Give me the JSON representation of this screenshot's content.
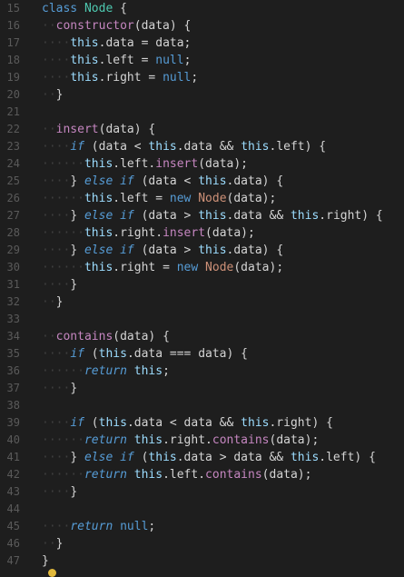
{
  "editor": {
    "lines": [
      {
        "n": "15",
        "tokens": [
          {
            "t": "class ",
            "c": "kw"
          },
          {
            "t": "Node",
            "c": "cls"
          },
          {
            "t": " {",
            "c": "punc"
          }
        ]
      },
      {
        "n": "16",
        "tokens": [
          {
            "t": "··",
            "c": "guide"
          },
          {
            "t": "constructor",
            "c": "fn2"
          },
          {
            "t": "(data) {",
            "c": "punc"
          }
        ]
      },
      {
        "n": "17",
        "tokens": [
          {
            "t": "····",
            "c": "guide"
          },
          {
            "t": "this",
            "c": "this"
          },
          {
            "t": ".data = data;",
            "c": "id"
          }
        ]
      },
      {
        "n": "18",
        "tokens": [
          {
            "t": "····",
            "c": "guide"
          },
          {
            "t": "this",
            "c": "this"
          },
          {
            "t": ".left = ",
            "c": "id"
          },
          {
            "t": "null",
            "c": "kw"
          },
          {
            "t": ";",
            "c": "punc"
          }
        ]
      },
      {
        "n": "19",
        "tokens": [
          {
            "t": "····",
            "c": "guide"
          },
          {
            "t": "this",
            "c": "this"
          },
          {
            "t": ".right = ",
            "c": "id"
          },
          {
            "t": "null",
            "c": "kw"
          },
          {
            "t": ";",
            "c": "punc"
          }
        ]
      },
      {
        "n": "20",
        "tokens": [
          {
            "t": "··",
            "c": "guide"
          },
          {
            "t": "}",
            "c": "punc"
          }
        ]
      },
      {
        "n": "21",
        "tokens": []
      },
      {
        "n": "22",
        "tokens": [
          {
            "t": "··",
            "c": "guide"
          },
          {
            "t": "insert",
            "c": "fn2"
          },
          {
            "t": "(data) {",
            "c": "punc"
          }
        ]
      },
      {
        "n": "23",
        "tokens": [
          {
            "t": "····",
            "c": "guide"
          },
          {
            "t": "if",
            "c": "kwi"
          },
          {
            "t": " (data < ",
            "c": "id"
          },
          {
            "t": "this",
            "c": "this"
          },
          {
            "t": ".data && ",
            "c": "id"
          },
          {
            "t": "this",
            "c": "this"
          },
          {
            "t": ".left) {",
            "c": "id"
          }
        ]
      },
      {
        "n": "24",
        "tokens": [
          {
            "t": "······",
            "c": "guide"
          },
          {
            "t": "this",
            "c": "this"
          },
          {
            "t": ".left.",
            "c": "id"
          },
          {
            "t": "insert",
            "c": "fn2"
          },
          {
            "t": "(data);",
            "c": "punc"
          }
        ]
      },
      {
        "n": "25",
        "tokens": [
          {
            "t": "····",
            "c": "guide"
          },
          {
            "t": "} ",
            "c": "punc"
          },
          {
            "t": "else if",
            "c": "kwi"
          },
          {
            "t": " (data < ",
            "c": "id"
          },
          {
            "t": "this",
            "c": "this"
          },
          {
            "t": ".data) {",
            "c": "id"
          }
        ]
      },
      {
        "n": "26",
        "tokens": [
          {
            "t": "······",
            "c": "guide"
          },
          {
            "t": "this",
            "c": "this"
          },
          {
            "t": ".left = ",
            "c": "id"
          },
          {
            "t": "new ",
            "c": "kw"
          },
          {
            "t": "Node",
            "c": "str"
          },
          {
            "t": "(data);",
            "c": "punc"
          }
        ]
      },
      {
        "n": "27",
        "tokens": [
          {
            "t": "····",
            "c": "guide"
          },
          {
            "t": "} ",
            "c": "punc"
          },
          {
            "t": "else if",
            "c": "kwi"
          },
          {
            "t": " (data > ",
            "c": "id"
          },
          {
            "t": "this",
            "c": "this"
          },
          {
            "t": ".data && ",
            "c": "id"
          },
          {
            "t": "this",
            "c": "this"
          },
          {
            "t": ".right) {",
            "c": "id"
          }
        ]
      },
      {
        "n": "28",
        "tokens": [
          {
            "t": "······",
            "c": "guide"
          },
          {
            "t": "this",
            "c": "this"
          },
          {
            "t": ".right.",
            "c": "id"
          },
          {
            "t": "insert",
            "c": "fn2"
          },
          {
            "t": "(data);",
            "c": "punc"
          }
        ]
      },
      {
        "n": "29",
        "tokens": [
          {
            "t": "····",
            "c": "guide"
          },
          {
            "t": "} ",
            "c": "punc"
          },
          {
            "t": "else if",
            "c": "kwi"
          },
          {
            "t": " (data > ",
            "c": "id"
          },
          {
            "t": "this",
            "c": "this"
          },
          {
            "t": ".data) {",
            "c": "id"
          }
        ]
      },
      {
        "n": "30",
        "tokens": [
          {
            "t": "······",
            "c": "guide"
          },
          {
            "t": "this",
            "c": "this"
          },
          {
            "t": ".right = ",
            "c": "id"
          },
          {
            "t": "new ",
            "c": "kw"
          },
          {
            "t": "Node",
            "c": "str"
          },
          {
            "t": "(data);",
            "c": "punc"
          }
        ]
      },
      {
        "n": "31",
        "tokens": [
          {
            "t": "····",
            "c": "guide"
          },
          {
            "t": "}",
            "c": "punc"
          }
        ]
      },
      {
        "n": "32",
        "tokens": [
          {
            "t": "··",
            "c": "guide"
          },
          {
            "t": "}",
            "c": "punc"
          }
        ]
      },
      {
        "n": "33",
        "tokens": []
      },
      {
        "n": "34",
        "tokens": [
          {
            "t": "··",
            "c": "guide"
          },
          {
            "t": "contains",
            "c": "fn2"
          },
          {
            "t": "(data) {",
            "c": "punc"
          }
        ]
      },
      {
        "n": "35",
        "tokens": [
          {
            "t": "····",
            "c": "guide"
          },
          {
            "t": "if",
            "c": "kwi"
          },
          {
            "t": " (",
            "c": "punc"
          },
          {
            "t": "this",
            "c": "this"
          },
          {
            "t": ".data === data) {",
            "c": "id"
          }
        ]
      },
      {
        "n": "36",
        "tokens": [
          {
            "t": "······",
            "c": "guide"
          },
          {
            "t": "return",
            "c": "kwi"
          },
          {
            "t": " ",
            "c": "punc"
          },
          {
            "t": "this",
            "c": "this"
          },
          {
            "t": ";",
            "c": "punc"
          }
        ]
      },
      {
        "n": "37",
        "tokens": [
          {
            "t": "····",
            "c": "guide"
          },
          {
            "t": "}",
            "c": "punc"
          }
        ]
      },
      {
        "n": "38",
        "tokens": []
      },
      {
        "n": "39",
        "tokens": [
          {
            "t": "····",
            "c": "guide"
          },
          {
            "t": "if",
            "c": "kwi"
          },
          {
            "t": " (",
            "c": "punc"
          },
          {
            "t": "this",
            "c": "this"
          },
          {
            "t": ".data < data && ",
            "c": "id"
          },
          {
            "t": "this",
            "c": "this"
          },
          {
            "t": ".right) {",
            "c": "id"
          }
        ]
      },
      {
        "n": "40",
        "tokens": [
          {
            "t": "······",
            "c": "guide"
          },
          {
            "t": "return",
            "c": "kwi"
          },
          {
            "t": " ",
            "c": "punc"
          },
          {
            "t": "this",
            "c": "this"
          },
          {
            "t": ".right.",
            "c": "id"
          },
          {
            "t": "contains",
            "c": "fn2"
          },
          {
            "t": "(data);",
            "c": "punc"
          }
        ]
      },
      {
        "n": "41",
        "tokens": [
          {
            "t": "····",
            "c": "guide"
          },
          {
            "t": "} ",
            "c": "punc"
          },
          {
            "t": "else if",
            "c": "kwi"
          },
          {
            "t": " (",
            "c": "punc"
          },
          {
            "t": "this",
            "c": "this"
          },
          {
            "t": ".data > data && ",
            "c": "id"
          },
          {
            "t": "this",
            "c": "this"
          },
          {
            "t": ".left) {",
            "c": "id"
          }
        ]
      },
      {
        "n": "42",
        "tokens": [
          {
            "t": "······",
            "c": "guide"
          },
          {
            "t": "return",
            "c": "kwi"
          },
          {
            "t": " ",
            "c": "punc"
          },
          {
            "t": "this",
            "c": "this"
          },
          {
            "t": ".left.",
            "c": "id"
          },
          {
            "t": "contains",
            "c": "fn2"
          },
          {
            "t": "(data);",
            "c": "punc"
          }
        ]
      },
      {
        "n": "43",
        "tokens": [
          {
            "t": "····",
            "c": "guide"
          },
          {
            "t": "}",
            "c": "punc"
          }
        ]
      },
      {
        "n": "44",
        "tokens": []
      },
      {
        "n": "45",
        "tokens": [
          {
            "t": "····",
            "c": "guide"
          },
          {
            "t": "return",
            "c": "kwi"
          },
          {
            "t": " ",
            "c": "punc"
          },
          {
            "t": "null",
            "c": "kw"
          },
          {
            "t": ";",
            "c": "punc"
          }
        ]
      },
      {
        "n": "46",
        "tokens": [
          {
            "t": "··",
            "c": "guide"
          },
          {
            "t": "}",
            "c": "punc"
          }
        ]
      },
      {
        "n": "47",
        "tokens": [
          {
            "t": "}",
            "c": "punc"
          }
        ]
      }
    ]
  },
  "colors": {
    "background": "#1e1e1e",
    "keyword": "#569cd6",
    "method": "#c586c0",
    "this": "#9cdcfe",
    "class": "#4ec9b0",
    "constructor_call": "#ce9178",
    "line_number": "#5a5a5a",
    "cursor_dot": "#e2b93b"
  }
}
